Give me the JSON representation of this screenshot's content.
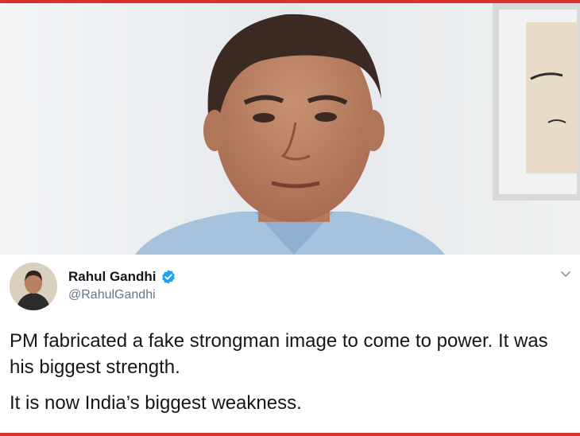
{
  "tweet": {
    "display_name": "Rahul Gandhi",
    "handle": "@RahulGandhi",
    "paragraphs": [
      "PM fabricated a fake strongman image to come to power. It was his biggest strength.",
      "It is now India’s biggest weakness."
    ]
  },
  "colors": {
    "accent_bar": "#d9322b",
    "verified": "#1da1f2",
    "text_primary": "#14171a",
    "text_secondary": "#657786"
  },
  "icons": {
    "verified": "verified-badge-icon",
    "menu": "chevron-down-icon"
  }
}
